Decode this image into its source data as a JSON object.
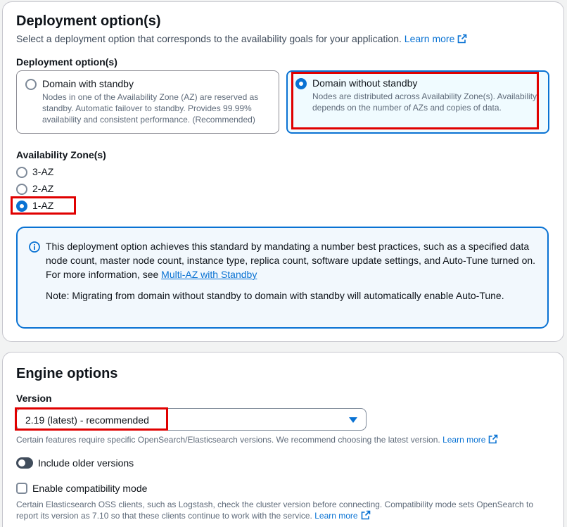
{
  "deployment": {
    "title": "Deployment option(s)",
    "description": "Select a deployment option that corresponds to the availability goals for your application.",
    "learn_more": "Learn more",
    "field_label": "Deployment option(s)",
    "options": [
      {
        "title": "Domain with standby",
        "desc": "Nodes in one of the Availability Zone (AZ) are reserved as standby. Automatic failover to standby. Provides 99.99% availability and consistent performance. (Recommended)",
        "selected": false
      },
      {
        "title": "Domain without standby",
        "desc": "Nodes are distributed across Availability Zone(s). Availability depends on the number of AZs and copies of data.",
        "selected": true
      }
    ],
    "az_label": "Availability Zone(s)",
    "az_options": [
      {
        "label": "3-AZ",
        "selected": false
      },
      {
        "label": "2-AZ",
        "selected": false
      },
      {
        "label": "1-AZ",
        "selected": true
      }
    ],
    "info": {
      "text": "This deployment option achieves this standard by mandating a number best practices, such as a specified data node count, master node count, instance type, replica count, software update settings, and Auto-Tune turned on. For more information, see ",
      "link": "Multi-AZ with Standby",
      "note": "Note: Migrating from domain without standby to domain with standby will automatically enable Auto-Tune."
    }
  },
  "engine": {
    "title": "Engine options",
    "version_label": "Version",
    "version_value": "2.19 (latest) - recommended",
    "version_hint": "Certain features require specific OpenSearch/Elasticsearch versions. We recommend choosing the latest version.",
    "learn_more": "Learn more",
    "older_versions_label": "Include older versions",
    "older_versions_on": false,
    "compat_label": "Enable compatibility mode",
    "compat_checked": false,
    "compat_hint": "Certain Elasticsearch OSS clients, such as Logstash, check the cluster version before connecting. Compatibility mode sets OpenSearch to report its version as 7.10 so that these clients continue to work with the service.",
    "compat_learn_more": "Learn more"
  },
  "colors": {
    "accent": "#0972d3",
    "highlight": "#e00000"
  }
}
